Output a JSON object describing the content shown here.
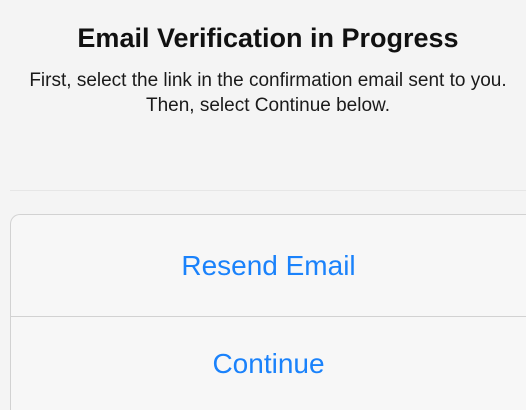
{
  "alert": {
    "title": "Email Verification in Progress",
    "message": "First, select the link in the confirmation email sent to you. Then, select Continue below."
  },
  "actions": {
    "resend_label": "Resend Email",
    "continue_label": "Continue"
  },
  "colors": {
    "action_tint": "#1a82fb",
    "background": "#f4f4f4"
  }
}
